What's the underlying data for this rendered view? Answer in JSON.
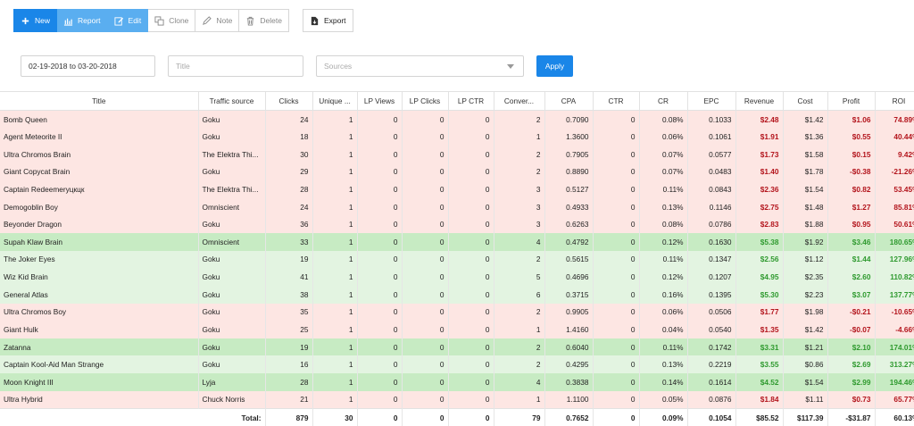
{
  "toolbar": {
    "new_label": "New",
    "report_label": "Report",
    "edit_label": "Edit",
    "clone_label": "Clone",
    "note_label": "Note",
    "delete_label": "Delete",
    "export_label": "Export"
  },
  "filters": {
    "date_range": "02-19-2018 to 03-20-2018",
    "title_placeholder": "Title",
    "sources_placeholder": "Sources",
    "apply_label": "Apply"
  },
  "table": {
    "columns": [
      "Title",
      "Traffic source",
      "Clicks",
      "Unique ...",
      "LP Views",
      "LP Clicks",
      "LP CTR",
      "Conver...",
      "CPA",
      "CTR",
      "CR",
      "EPC",
      "Revenue",
      "Cost",
      "Profit",
      "ROI"
    ],
    "rows": [
      {
        "tone": "neg",
        "cells": [
          "Bomb Queen",
          "Goku",
          "24",
          "1",
          "0",
          "0",
          "0",
          "2",
          "0.7090",
          "0",
          "0.08%",
          "0.1033",
          "$2.48",
          "$1.42",
          "$1.06",
          "74.89%"
        ]
      },
      {
        "tone": "neg",
        "cells": [
          "Agent Meteorite II",
          "Goku",
          "18",
          "1",
          "0",
          "0",
          "0",
          "1",
          "1.3600",
          "0",
          "0.06%",
          "0.1061",
          "$1.91",
          "$1.36",
          "$0.55",
          "40.44%"
        ]
      },
      {
        "tone": "neg",
        "cells": [
          "Ultra Chromos Brain",
          "The Elektra Thi...",
          "30",
          "1",
          "0",
          "0",
          "0",
          "2",
          "0.7905",
          "0",
          "0.07%",
          "0.0577",
          "$1.73",
          "$1.58",
          "$0.15",
          "9.42%"
        ]
      },
      {
        "tone": "neg",
        "cells": [
          "Giant Copycat Brain",
          "Goku",
          "29",
          "1",
          "0",
          "0",
          "0",
          "2",
          "0.8890",
          "0",
          "0.07%",
          "0.0483",
          "$1.40",
          "$1.78",
          "-$0.38",
          "-21.26%"
        ]
      },
      {
        "tone": "neg",
        "cells": [
          "Captain Redeemerуцкцк",
          "The Elektra Thi...",
          "28",
          "1",
          "0",
          "0",
          "0",
          "3",
          "0.5127",
          "0",
          "0.11%",
          "0.0843",
          "$2.36",
          "$1.54",
          "$0.82",
          "53.45%"
        ]
      },
      {
        "tone": "neg",
        "cells": [
          "Demogoblin Boy",
          "Omniscient",
          "24",
          "1",
          "0",
          "0",
          "0",
          "3",
          "0.4933",
          "0",
          "0.13%",
          "0.1146",
          "$2.75",
          "$1.48",
          "$1.27",
          "85.81%"
        ]
      },
      {
        "tone": "neg",
        "cells": [
          "Beyonder Dragon",
          "Goku",
          "36",
          "1",
          "0",
          "0",
          "0",
          "3",
          "0.6263",
          "0",
          "0.08%",
          "0.0786",
          "$2.83",
          "$1.88",
          "$0.95",
          "50.61%"
        ]
      },
      {
        "tone": "posd",
        "cells": [
          "Supah Klaw Brain",
          "Omniscient",
          "33",
          "1",
          "0",
          "0",
          "0",
          "4",
          "0.4792",
          "0",
          "0.12%",
          "0.1630",
          "$5.38",
          "$1.92",
          "$3.46",
          "180.65%"
        ]
      },
      {
        "tone": "pos",
        "cells": [
          "The Joker Eyes",
          "Goku",
          "19",
          "1",
          "0",
          "0",
          "0",
          "2",
          "0.5615",
          "0",
          "0.11%",
          "0.1347",
          "$2.56",
          "$1.12",
          "$1.44",
          "127.96%"
        ]
      },
      {
        "tone": "pos",
        "cells": [
          "Wiz Kid Brain",
          "Goku",
          "41",
          "1",
          "0",
          "0",
          "0",
          "5",
          "0.4696",
          "0",
          "0.12%",
          "0.1207",
          "$4.95",
          "$2.35",
          "$2.60",
          "110.82%"
        ]
      },
      {
        "tone": "pos",
        "cells": [
          "General Atlas",
          "Goku",
          "38",
          "1",
          "0",
          "0",
          "0",
          "6",
          "0.3715",
          "0",
          "0.16%",
          "0.1395",
          "$5.30",
          "$2.23",
          "$3.07",
          "137.77%"
        ]
      },
      {
        "tone": "neg",
        "cells": [
          "Ultra Chromos Boy",
          "Goku",
          "35",
          "1",
          "0",
          "0",
          "0",
          "2",
          "0.9905",
          "0",
          "0.06%",
          "0.0506",
          "$1.77",
          "$1.98",
          "-$0.21",
          "-10.65%"
        ]
      },
      {
        "tone": "neg",
        "cells": [
          "Giant Hulk",
          "Goku",
          "25",
          "1",
          "0",
          "0",
          "0",
          "1",
          "1.4160",
          "0",
          "0.04%",
          "0.0540",
          "$1.35",
          "$1.42",
          "-$0.07",
          "-4.66%"
        ]
      },
      {
        "tone": "posd",
        "cells": [
          "Zatanna",
          "Goku",
          "19",
          "1",
          "0",
          "0",
          "0",
          "2",
          "0.6040",
          "0",
          "0.11%",
          "0.1742",
          "$3.31",
          "$1.21",
          "$2.10",
          "174.01%"
        ]
      },
      {
        "tone": "pos",
        "cells": [
          "Captain Kool-Aid Man Strange",
          "Goku",
          "16",
          "1",
          "0",
          "0",
          "0",
          "2",
          "0.4295",
          "0",
          "0.13%",
          "0.2219",
          "$3.55",
          "$0.86",
          "$2.69",
          "313.27%"
        ]
      },
      {
        "tone": "posd",
        "cells": [
          "Moon Knight III",
          "Lyja",
          "28",
          "1",
          "0",
          "0",
          "0",
          "4",
          "0.3838",
          "0",
          "0.14%",
          "0.1614",
          "$4.52",
          "$1.54",
          "$2.99",
          "194.46%"
        ]
      },
      {
        "tone": "neg",
        "cells": [
          "Ultra Hybrid",
          "Chuck Norris",
          "21",
          "1",
          "0",
          "0",
          "0",
          "1",
          "1.1100",
          "0",
          "0.05%",
          "0.0876",
          "$1.84",
          "$1.11",
          "$0.73",
          "65.77%"
        ]
      }
    ],
    "total": [
      "Total:",
      "879",
      "30",
      "0",
      "0",
      "0",
      "79",
      "0.7652",
      "0",
      "0.09%",
      "0.1054",
      "$85.52",
      "$117.39",
      "-$31.87",
      "60.13%"
    ]
  },
  "colors": {
    "primary": "#1a86e8",
    "active": "#5aaef0",
    "negative_row": "#fde6e3",
    "positive_row": "#e3f4e1",
    "positive_row_strong": "#c7ebc3",
    "red_text": "#b3141c",
    "green_text": "#2f9a2f"
  },
  "icons": [
    "plus-icon",
    "bar-chart-icon",
    "edit-icon",
    "clone-icon",
    "pencil-icon",
    "trash-icon",
    "export-icon",
    "chevron-down-icon"
  ]
}
